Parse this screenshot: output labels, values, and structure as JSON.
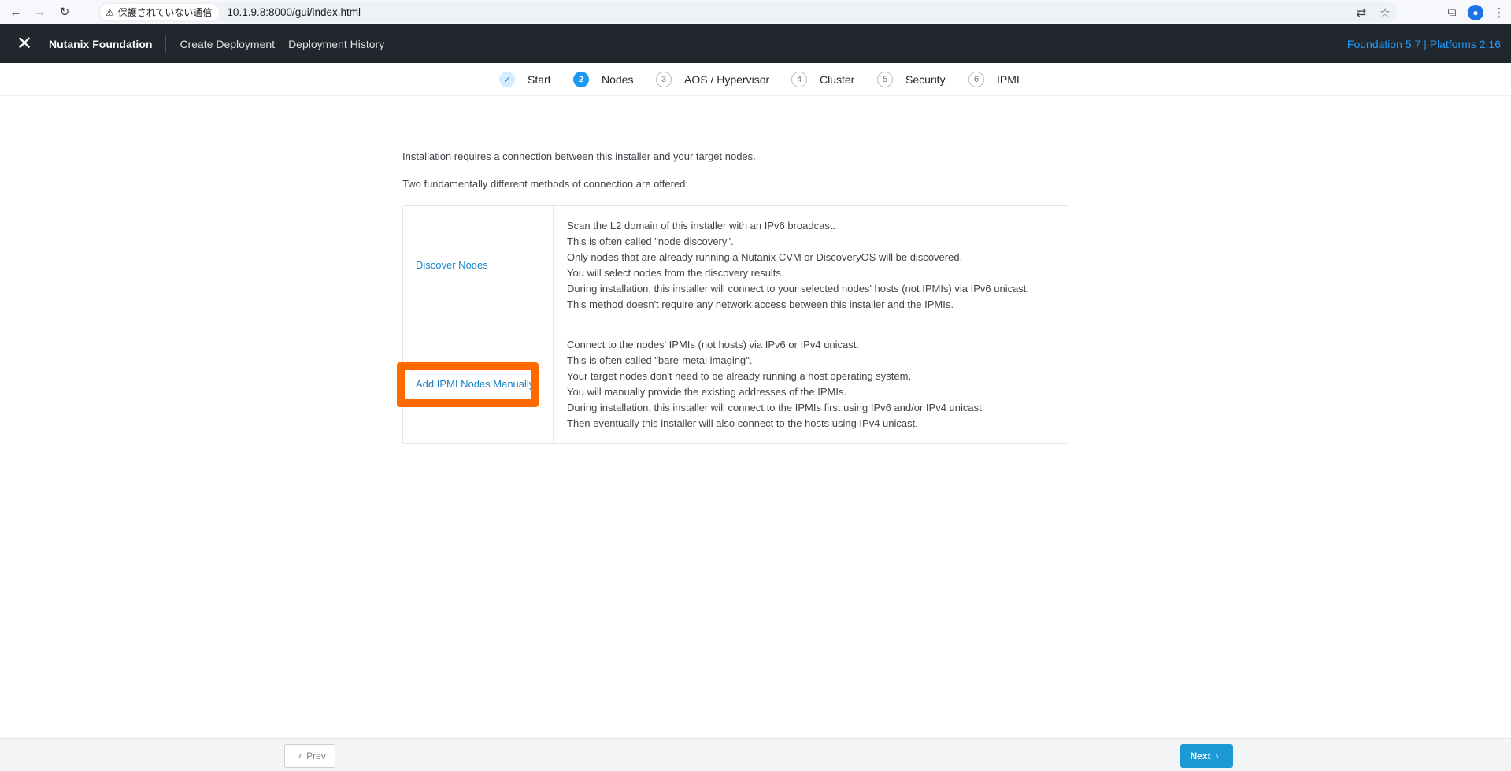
{
  "browser": {
    "security_label": "保護されていない通信",
    "url": "10.1.9.8:8000/gui/index.html"
  },
  "header": {
    "brand": "Nutanix Foundation",
    "links": [
      "Create Deployment",
      "Deployment History"
    ],
    "version": "Foundation 5.7 | Platforms 2.16"
  },
  "steps": [
    {
      "number": "✓",
      "label": "Start",
      "state": "done"
    },
    {
      "number": "2",
      "label": "Nodes",
      "state": "active"
    },
    {
      "number": "3",
      "label": "AOS / Hypervisor",
      "state": "todo"
    },
    {
      "number": "4",
      "label": "Cluster",
      "state": "todo"
    },
    {
      "number": "5",
      "label": "Security",
      "state": "todo"
    },
    {
      "number": "6",
      "label": "IPMI",
      "state": "todo"
    }
  ],
  "intro": {
    "line1": "Installation requires a connection between this installer and your target nodes.",
    "line2": "Two fundamentally different methods of connection are offered:"
  },
  "methods": [
    {
      "link": "Discover Nodes",
      "lines": [
        "Scan the L2 domain of this installer with an IPv6 broadcast.",
        "This is often called \"node discovery\".",
        "Only nodes that are already running a Nutanix CVM or DiscoveryOS will be discovered.",
        "You will select nodes from the discovery results.",
        "During installation, this installer will connect to your selected nodes' hosts (not IPMIs) via IPv6 unicast.",
        "This method doesn't require any network access between this installer and the IPMIs."
      ]
    },
    {
      "link": "Add IPMI Nodes Manually",
      "lines": [
        "Connect to the nodes' IPMIs (not hosts) via IPv6 or IPv4 unicast.",
        "This is often called \"bare-metal imaging\".",
        "Your target nodes don't need to be already running a host operating system.",
        "You will manually provide the existing addresses of the IPMIs.",
        "During installation, this installer will connect to the IPMIs first using IPv6 and/or IPv4 unicast.",
        "Then eventually this installer will also connect to the hosts using IPv4 unicast."
      ]
    }
  ],
  "footer": {
    "prev": "Prev",
    "next": "Next"
  },
  "colors": {
    "header_bg": "#22272e",
    "accent": "#1c9ad6",
    "highlight": "#ff6a00"
  }
}
